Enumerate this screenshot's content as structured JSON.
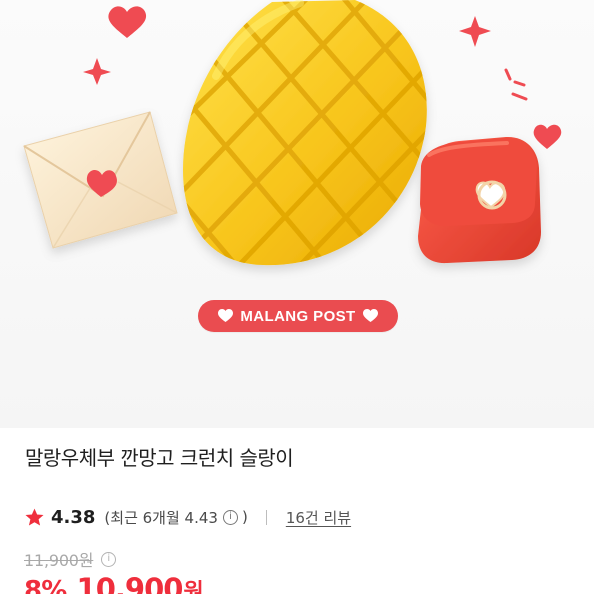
{
  "hero": {
    "badge": {
      "label": "MALANG POST",
      "left_icon": "heart-icon",
      "right_icon": "heart-icon",
      "background": "#ea4c50",
      "text_color": "#ffffff"
    },
    "decorations": {
      "heart_color": "#ef4b52",
      "sparkle_color": "#ef4b52",
      "mango_color": "#f8c51c",
      "envelope_color": "#f5e4c5",
      "bag_color": "#e94232"
    }
  },
  "product": {
    "title": "말랑우체부 깐망고 크런치 슬랑이",
    "rating": {
      "icon": "star-icon",
      "value": "4.38",
      "recent_label": "(최근 6개월 4.43",
      "info_icon": "info-icon",
      "close_paren": ")",
      "review_count": "16건 리뷰"
    },
    "pricing": {
      "original_price": "11,900원",
      "info_icon": "info-icon",
      "discount": "8%",
      "sale_price": "10,900",
      "currency": "원",
      "accent_color": "#ef2e3c"
    }
  }
}
